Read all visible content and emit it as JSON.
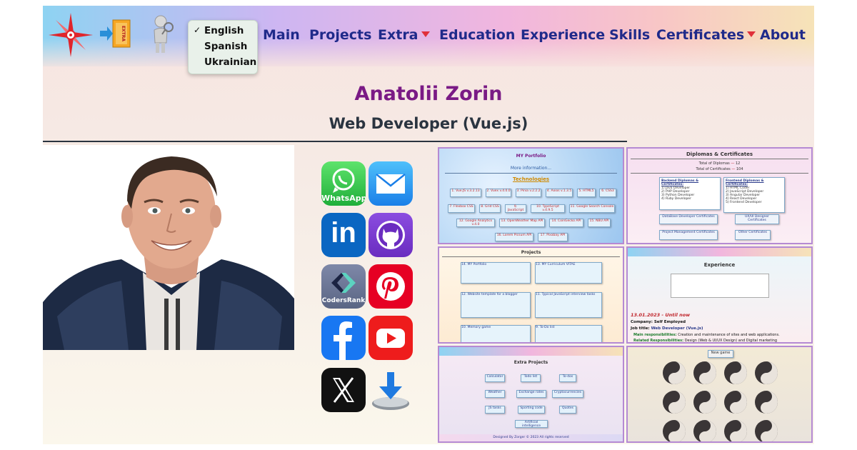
{
  "header": {
    "language_menu": {
      "selected": "English",
      "options": [
        "English",
        "Spanish",
        "Ukrainian"
      ]
    },
    "nav": [
      {
        "label": "Main",
        "dropdown": false
      },
      {
        "label": "Projects",
        "dropdown": false
      },
      {
        "label": "Extra",
        "dropdown": true
      },
      {
        "label": "Education",
        "dropdown": false
      },
      {
        "label": "Experience",
        "dropdown": false
      },
      {
        "label": "Skills",
        "dropdown": false
      },
      {
        "label": "Certificates",
        "dropdown": true
      },
      {
        "label": "About",
        "dropdown": false
      }
    ],
    "extra_badge_text": "EXTRA"
  },
  "profile": {
    "name": "Anatolii Zorin",
    "role": "Web Developer (Vue.js)"
  },
  "social": {
    "whatsapp": "WhatsApp",
    "codersrank": "CodersRank",
    "linkedin": "in"
  },
  "thumbnails": {
    "portfolio": {
      "title": "MY Portfolio",
      "more": "More information...",
      "technologies_title": "Technologies",
      "chips": [
        "1. Vue.JS v.3.2.13",
        "2. Vuex v.4.0.0",
        "3. Pinia v.2.2.2",
        "4. Axios v.1.3.5",
        "5. HTML5",
        "6. CSS3",
        "7. Flexbox CSS",
        "8. Grid CSS",
        "9. JavaScript",
        "10. TypeScript v.4.9.5",
        "11. Google Search Console",
        "12. Google Analytics v.4.0",
        "13. OpenWeather Map API",
        "14. CoinGecko API",
        "15. NBU API",
        "16. Lorem Picsum API",
        "17. Pixabay API"
      ]
    },
    "diplomas": {
      "title": "Diplomas & Certificates",
      "total_diplomas_label": "Total of Diplomas",
      "total_diplomas": "12",
      "total_certificates_label": "Total of Certificates",
      "total_certificates": "104",
      "backend_title": "Backend Diplomas & Certificates:",
      "backend_items": [
        "1) Java Developer",
        "2) PHP Developer",
        "3) Python Developer",
        "4) Ruby Developer"
      ],
      "frontend_title": "Frontend Diplomas & Certificates:",
      "frontend_items": [
        "1) HTML Coder",
        "2) JavaScript Developer",
        "3) Angular Developer",
        "4) React Developer",
        "5) Frontend Developer"
      ],
      "buttons": [
        "DataBase Developer Certificates",
        "UX/UI Designer Certificates",
        "Project Management Certificates",
        "Other Certificates"
      ]
    },
    "projects": {
      "title": "Projects",
      "cards": [
        "14. MY Portfolio",
        "13. MY Curriculum VITAE",
        "12. Website template for a blogger",
        "11. Typical JavaScript interview tasks",
        "10. Memory game",
        "9. To-Do list"
      ]
    },
    "experience": {
      "title": "Experience",
      "date": "13.01.2023 - Until now",
      "company_label": "Company:",
      "company": "Self Employed",
      "job_label": "Job title:",
      "job": "Web Developer (Vue.js)",
      "resp_label": "Main responsibilities:",
      "resp": "Creation and maintenance of sites and web applications.",
      "related_label": "Related Responsibilities:",
      "related": "Design (Web & UI/UX Design) and Digital marketing"
    },
    "extra_projects": {
      "title": "Extra Projects",
      "items": [
        "Calculator",
        "Todo list",
        "To-dos",
        "Weather",
        "Exchange rates",
        "Cryptocurrencies",
        "JS tasks",
        "Sporting code",
        "Quotes",
        "Artificial intelligence"
      ],
      "footer": "Designed By Zorger © 2023 All rights reserved"
    },
    "memory_game": {
      "button": "New game"
    }
  },
  "colors": {
    "nav_text": "#1f2a8a",
    "name_text": "#7a1a85",
    "caret": "#e0303a",
    "thumb_border": "#b58ad3"
  }
}
